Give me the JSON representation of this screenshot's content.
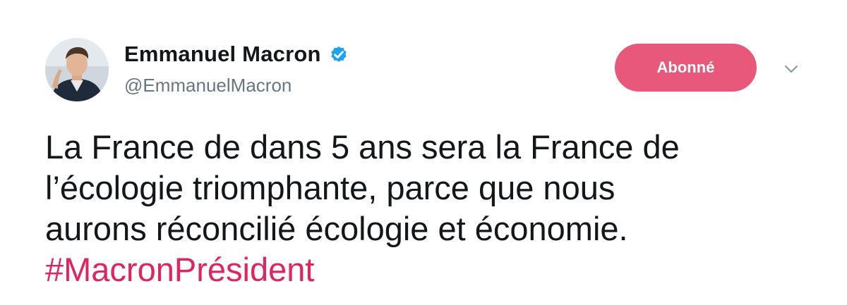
{
  "author": {
    "display_name": "Emmanuel Macron",
    "handle": "@EmmanuelMacron",
    "verified": true
  },
  "follow_button": {
    "label": "Abonné",
    "color": "#e8587a"
  },
  "tweet": {
    "lines": [
      "La France de dans 5 ans sera la France de",
      "l’écologie triomphante, parce que nous",
      "aurons réconcilié écologie et économie."
    ],
    "hashtag": "#MacronPrésident",
    "hashtag_color": "#e0245e"
  },
  "icons": {
    "verified": "verified-badge-icon",
    "menu": "chevron-down-icon"
  }
}
